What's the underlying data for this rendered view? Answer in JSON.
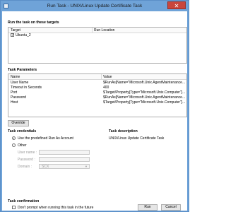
{
  "window": {
    "title": "Run Task - UNIX/Linux Update Certificate Task",
    "close_glyph": "✕"
  },
  "targets": {
    "heading": "Run the task on these targets",
    "columns": [
      "Target",
      "Run Location"
    ],
    "rows": [
      {
        "target": "Ubuntu_2",
        "run_location": "",
        "checked": true
      }
    ]
  },
  "parameters": {
    "heading": "Task Parameters",
    "columns": [
      "Name",
      "Value"
    ],
    "rows": [
      {
        "name": "User Name",
        "value": "$RunAs[Name=\"Microsoft.Unix.AgentMaintenance..."
      },
      {
        "name": "Timeout in Seconds",
        "value": "400"
      },
      {
        "name": "Port",
        "value": "$Target/Property[Type=\"Microsoft.Unix.Computer\"]..."
      },
      {
        "name": "Password",
        "value": "$RunAs[Name=\"Microsoft.Unix.AgentMaintenance..."
      },
      {
        "name": "Host",
        "value": "$Target/Property[Type=\"Microsoft.Unix.Computer\"]..."
      }
    ],
    "override_label": "Override"
  },
  "credentials": {
    "heading": "Task credentials",
    "use_predefined_label": "Use the predefined Run As Account",
    "other_label": "Other",
    "selected": "predefined",
    "username_label": "User name :",
    "password_label": "Password :",
    "domain_label": "Domain :",
    "domain_value": "SCX"
  },
  "description": {
    "heading": "Task description",
    "text": "UNIX/Linux Update Certificate Task"
  },
  "confirmation": {
    "heading": "Task confirmation",
    "dont_prompt_label": "Don't prompt when running this task in the future",
    "checked": false
  },
  "footer": {
    "run_label": "Run",
    "cancel_label": "Cancel"
  }
}
